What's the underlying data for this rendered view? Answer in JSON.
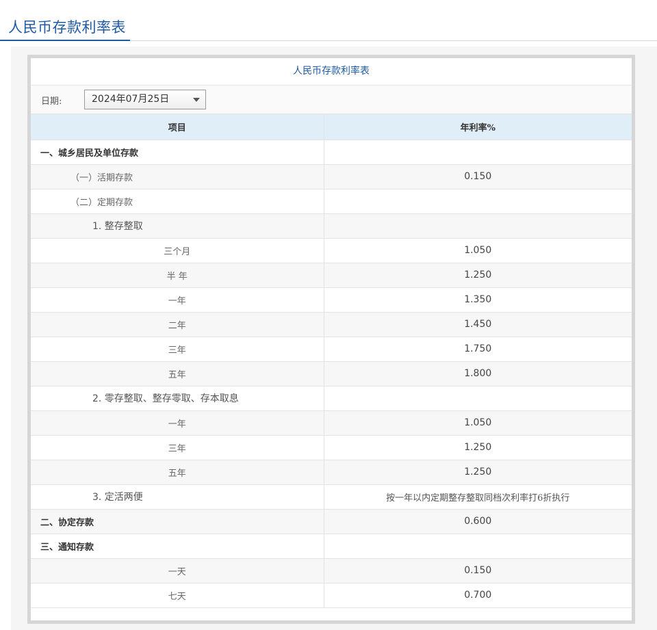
{
  "page": {
    "title": "人民币存款利率表"
  },
  "table": {
    "caption": "人民币存款利率表",
    "date_label": "日期:",
    "date_value": "2024年07月25日",
    "headers": {
      "item": "项目",
      "rate": "年利率%"
    },
    "rows": [
      {
        "label": "一、城乡居民及单位存款",
        "rate": "",
        "level": 0
      },
      {
        "label": "（一）活期存款",
        "rate": "0.150",
        "level": 1
      },
      {
        "label": "（二）定期存款",
        "rate": "",
        "level": 1
      },
      {
        "label": "1. 整存整取",
        "rate": "",
        "level": 2
      },
      {
        "label": "三个月",
        "rate": "1.050",
        "level": 3
      },
      {
        "label": "半 年",
        "rate": "1.250",
        "level": 3
      },
      {
        "label": "一年",
        "rate": "1.350",
        "level": 3
      },
      {
        "label": "二年",
        "rate": "1.450",
        "level": 3
      },
      {
        "label": "三年",
        "rate": "1.750",
        "level": 3
      },
      {
        "label": "五年",
        "rate": "1.800",
        "level": 3
      },
      {
        "label": "2. 零存整取、整存零取、存本取息",
        "rate": "",
        "level": 2
      },
      {
        "label": "一年",
        "rate": "1.050",
        "level": 3
      },
      {
        "label": "三年",
        "rate": "1.250",
        "level": 3
      },
      {
        "label": "五年",
        "rate": "1.250",
        "level": 3
      },
      {
        "label": "3. 定活两便",
        "rate": "按一年以内定期整存整取同档次利率打6折执行",
        "level": 2
      },
      {
        "label": "二、协定存款",
        "rate": "0.600",
        "level": 0
      },
      {
        "label": "三、通知存款",
        "rate": "",
        "level": 0
      },
      {
        "label": "一天",
        "rate": "0.150",
        "level": 3
      },
      {
        "label": "七天",
        "rate": "0.700",
        "level": 3
      }
    ]
  }
}
